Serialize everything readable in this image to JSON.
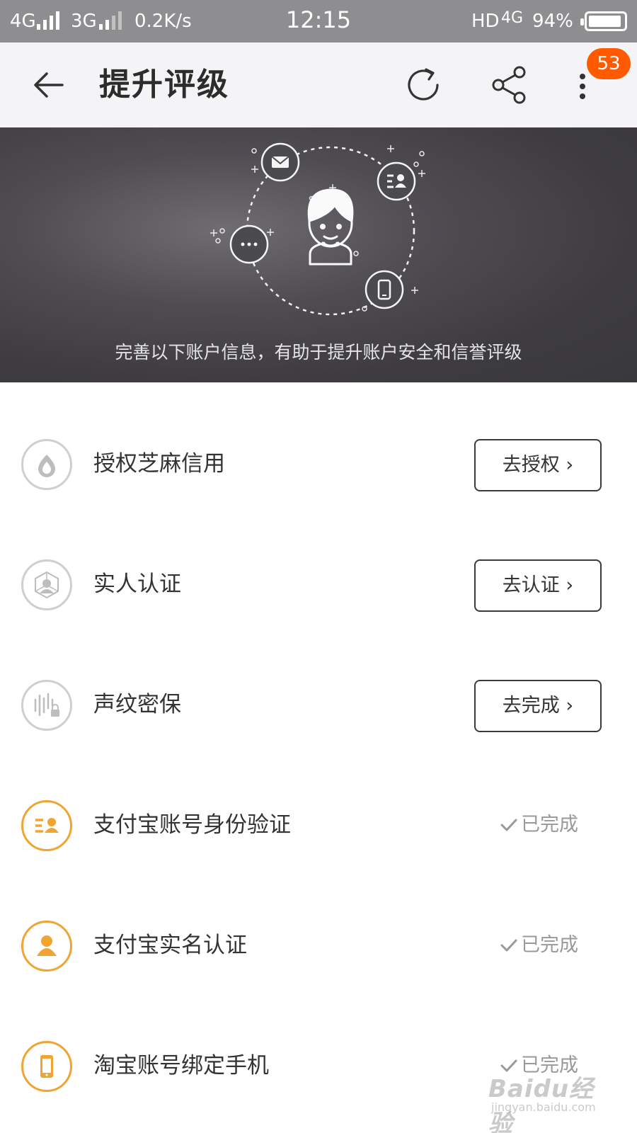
{
  "status_bar": {
    "network_left": "4G",
    "network_mid": "3G",
    "speed": "0.2K/s",
    "time": "12:15",
    "right_label": "HD",
    "right_network": "4G",
    "battery": "94%",
    "battery_level": 0.94
  },
  "header": {
    "title": "提升评级",
    "badge_count": "53",
    "icons": [
      "back-arrow-icon",
      "refresh-icon",
      "share-icon",
      "more-vertical-icon"
    ]
  },
  "hero": {
    "caption": "完善以下账户信息，有助于提升账户安全和信誉评级",
    "icons": [
      "avatar-icon",
      "mail-icon",
      "id-card-icon",
      "chat-icon",
      "phone-icon"
    ]
  },
  "items": [
    {
      "label": "授权芝麻信用",
      "action": "去授权 ›",
      "status": "",
      "icon": "sesame-credit-icon",
      "done": false
    },
    {
      "label": "实人认证",
      "action": "去认证 ›",
      "status": "",
      "icon": "face-scan-icon",
      "done": false
    },
    {
      "label": "声纹密保",
      "action": "去完成 ›",
      "status": "",
      "icon": "voiceprint-lock-icon",
      "done": false
    },
    {
      "label": "支付宝账号身份验证",
      "action": "",
      "status": "已完成",
      "icon": "id-card-icon",
      "done": true
    },
    {
      "label": "支付宝实名认证",
      "action": "",
      "status": "已完成",
      "icon": "person-icon",
      "done": true
    },
    {
      "label": "淘宝账号绑定手机",
      "action": "",
      "status": "已完成",
      "icon": "phone-icon",
      "done": true
    }
  ],
  "colors": {
    "accent": "#f0a533",
    "badge": "#ff5a00",
    "status_bar": "#8e8e91",
    "header_bg": "#f4f4f6"
  },
  "watermark": {
    "main": "Baidu经验",
    "sub": "jingyan.baidu.com"
  }
}
